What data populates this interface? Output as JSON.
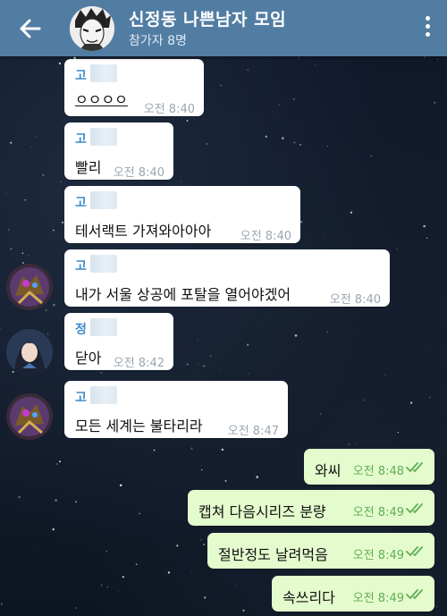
{
  "header": {
    "title": "신정동 나쁜남자 모임",
    "subtitle": "참가자 8명"
  },
  "messages": [
    {
      "sender": "고",
      "text": "ㅇㅇㅇㅇ",
      "time": "오전 8:40"
    },
    {
      "sender": "고",
      "text": "빨리",
      "time": "오전 8:40"
    },
    {
      "sender": "고",
      "text": "테서랙트 가져와아아아",
      "time": "오전 8:40"
    },
    {
      "sender": "고",
      "text": "내가 서울 상공에 포탈을 열어야겠어",
      "time": "오전 8:40"
    },
    {
      "sender": "정",
      "text": "닫아",
      "time": "오전 8:42"
    },
    {
      "sender": "고",
      "text": "모든 세계는 불타리라",
      "time": "오전 8:47"
    }
  ],
  "outgoing": [
    {
      "text": "와씨",
      "time": "오전 8:48"
    },
    {
      "text": "캡쳐 다음시리즈 분량",
      "time": "오전 8:49"
    },
    {
      "text": "절반정도 날려먹음",
      "time": "오전 8:49"
    },
    {
      "text": "속쓰리다",
      "time": "오전 8:49"
    }
  ],
  "colors": {
    "header": "#527da3",
    "incoming_bubble": "#ffffff",
    "outgoing_bubble": "#e4fbcd",
    "sender_name": "#3e8ac8",
    "read_ticks": "#5fae56"
  },
  "icons": [
    "back-arrow-icon",
    "more-vertical-icon",
    "double-check-icon"
  ]
}
